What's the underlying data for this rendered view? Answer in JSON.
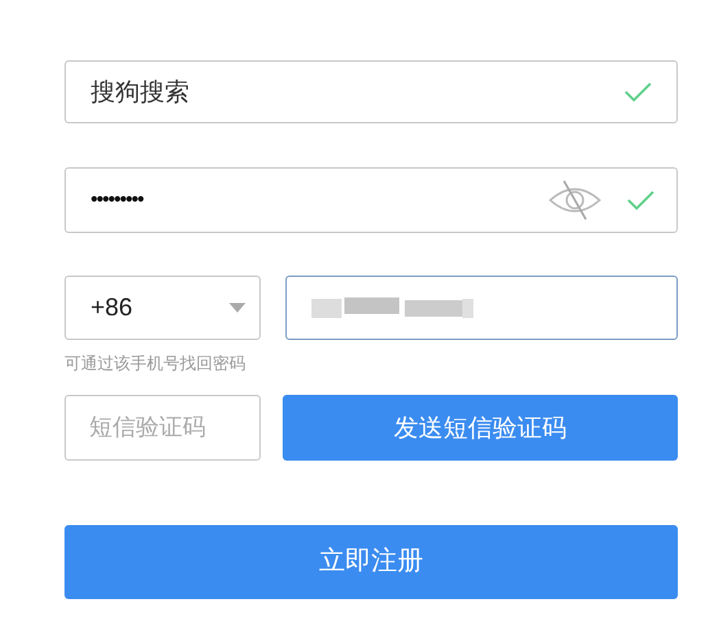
{
  "username": {
    "value": "搜狗搜索",
    "valid": true
  },
  "password": {
    "value": "•••••••••",
    "visible": false,
    "valid": true
  },
  "phone": {
    "country_code": "+86",
    "focused": true,
    "hint": "可通过该手机号找回密码"
  },
  "sms_code": {
    "placeholder": "短信验证码",
    "send_button": "发送短信验证码"
  },
  "register_button": "立即注册"
}
